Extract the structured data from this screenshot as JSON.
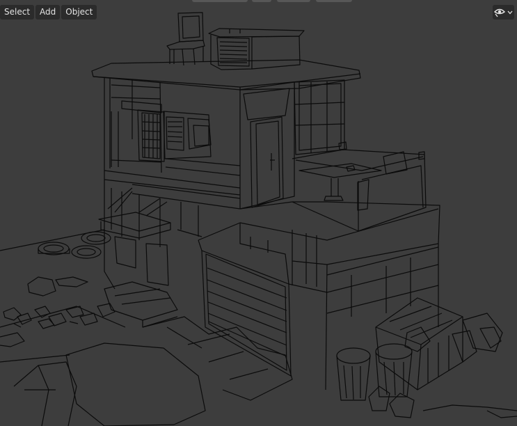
{
  "header": {
    "menus": [
      "Select",
      "Add",
      "Object"
    ]
  },
  "overlay": {
    "icon": "eye-icon",
    "dropdown_icon": "chevron-down-icon"
  },
  "colors": {
    "viewport_bg": "#3d3d3d",
    "wire": "#0b0b0b",
    "button_bg": "#2b2b2b",
    "button_text": "#e2e2e2"
  }
}
